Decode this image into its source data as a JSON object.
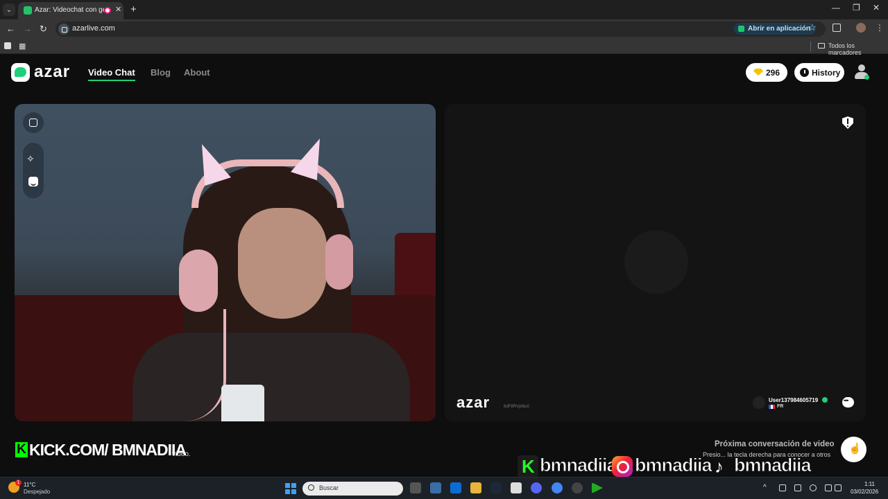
{
  "browser": {
    "tab_title": "Azar: Videochat con gente",
    "url": "azarlive.com",
    "open_in_app": "Abrir en aplicación",
    "all_bookmarks": "Todos los marcadores"
  },
  "header": {
    "logo": "azar",
    "nav": [
      "Video Chat",
      "Blog",
      "About"
    ],
    "gems": "296",
    "history_label": "History"
  },
  "remote": {
    "watermark": "azar",
    "watermark_code": "6dF8RVpMu0",
    "username": "User137984605719",
    "country": "FR"
  },
  "next": {
    "title": "Próxima conversación de video",
    "subtitle": "Presio... la tecla derecha para conocer a otros",
    "left_fragment": "video."
  },
  "overlays": {
    "kick": "KICK.COM/ BMNADIIA",
    "kick_badge": "K",
    "social_1": "bmnadiia",
    "social_2": "bmnadiia_",
    "social_3": "bmnadiia"
  },
  "taskbar": {
    "temperature": "11°C",
    "weather": "Despejado",
    "weather_badge": "1",
    "search_placeholder": "Buscar",
    "time": "1:11",
    "date": "03/02/2026"
  },
  "colors": {
    "accent": "#1fd07a",
    "gem": "#f4c300"
  }
}
